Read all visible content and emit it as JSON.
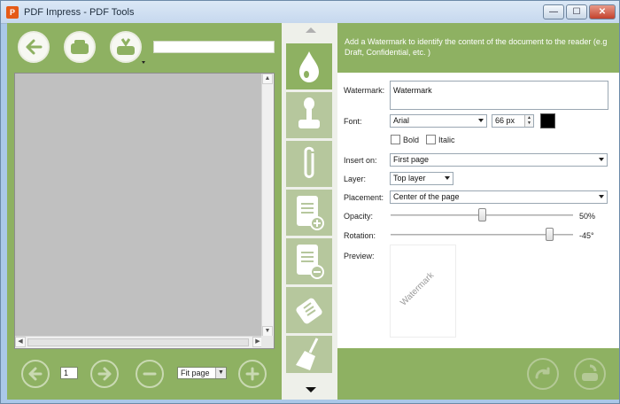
{
  "window": {
    "title": "PDF Impress - PDF Tools",
    "app_icon": "pdf-impress-logo",
    "controls": {
      "minimize": "—",
      "maximize": "☐",
      "close": "✕"
    }
  },
  "toolbar": {
    "icons": [
      "back-arrow-icon",
      "open-folder-icon",
      "save-download-icon"
    ],
    "path_value": ""
  },
  "navigation": {
    "page_number": "1",
    "zoom_value": "Fit page",
    "icons": [
      "prev-page-icon",
      "next-page-icon",
      "zoom-out-icon",
      "zoom-in-icon"
    ]
  },
  "tools": [
    {
      "name": "watermark",
      "icon": "drop-icon",
      "active": true
    },
    {
      "name": "stamp",
      "icon": "stamp-icon",
      "active": false
    },
    {
      "name": "attach",
      "icon": "paperclip-icon",
      "active": false
    },
    {
      "name": "add-pages",
      "icon": "add-document-icon",
      "active": false
    },
    {
      "name": "remove-pages",
      "icon": "remove-document-icon",
      "active": false
    },
    {
      "name": "erase",
      "icon": "eraser-icon",
      "active": false
    },
    {
      "name": "clean",
      "icon": "broom-icon",
      "active": false
    }
  ],
  "watermark_panel": {
    "description": "Add a Watermark to identify the content of the document to the reader (e.g Draft, Confidential, etc. )",
    "watermark_label": "Watermark:",
    "watermark_value": "Watermark",
    "font_label": "Font:",
    "font_value": "Arial",
    "font_size": "66 px",
    "font_color": "#000000",
    "bold_label": "Bold",
    "italic_label": "Italic",
    "bold_checked": false,
    "italic_checked": false,
    "insert_label": "Insert on:",
    "insert_value": "First page",
    "layer_label": "Layer:",
    "layer_value": "Top layer",
    "placement_label": "Placement:",
    "placement_value": "Center of the page",
    "opacity_label": "Opacity:",
    "opacity_value": "50%",
    "opacity_fraction": 0.5,
    "rotation_label": "Rotation:",
    "rotation_value": "-45°",
    "preview_label": "Preview:",
    "preview_text": "Watermark"
  },
  "footer": {
    "icons": [
      "redo-icon",
      "save-to-drive-icon"
    ]
  },
  "colors": {
    "panel_green": "#8eb162",
    "tool_inactive": "#b6c79d",
    "document_gray": "#c0c0c0"
  }
}
